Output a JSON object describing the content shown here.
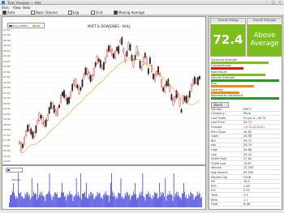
{
  "window": {
    "title": "Tickr Analysis — AAL"
  },
  "menu": [
    "Files",
    "View",
    "Help"
  ],
  "toolbar": [
    {
      "label": "Auto",
      "checked": true
    },
    {
      "label": "Basic Volume",
      "checked": false
    },
    {
      "label": "Log",
      "checked": false
    },
    {
      "label": "Grid",
      "checked": false
    },
    {
      "label": "Moving Average",
      "checked": true
    }
  ],
  "chart": {
    "title": "MSFT & DOWJONES - NULL",
    "legend": [
      "Price (MSFT)",
      "MA"
    ],
    "y_ticks": [
      "27.50",
      "27.00",
      "26.50",
      "26.00",
      "25.50",
      "25.00",
      "24.50",
      "24.00",
      "23.50",
      "23.00",
      "22.50",
      "22.00",
      "21.50",
      "21.00",
      "20.50",
      "20.00",
      "19.50",
      "19.00",
      "18.50",
      "18.00",
      "17.50",
      "17.00",
      "16.50",
      "16.00",
      "15.50",
      "15.00"
    ],
    "volume_legend": "Volume",
    "colors": {
      "up": "#d41010",
      "down": "#222222",
      "ma": "#e8a21c",
      "volume": "#2a2ad8"
    }
  },
  "scores": [
    {
      "header": "Overall Rating",
      "value": "72.4"
    },
    {
      "header": "Overall Strength",
      "value": "Above Average"
    }
  ],
  "bars": [
    {
      "label": "Technical Strength",
      "level": 0.82,
      "color": "#7cbf1a"
    },
    {
      "label": "Fundamentals",
      "level": 0.47,
      "color": "#e01a10"
    },
    {
      "label": "Momentum",
      "level": 0.78,
      "color": "#7cbf1a"
    },
    {
      "label": "Volume Strength",
      "level": 0.98,
      "color": "#1f9e1f"
    },
    {
      "label": "Risk",
      "level": 0.62,
      "color": "#f08a10"
    },
    {
      "label": "Volatility",
      "level": 0.41,
      "color": "#f08a10"
    },
    {
      "label": "Momentum Sentiment",
      "level": 0.98,
      "color": "#1f9e1f"
    }
  ],
  "details": {
    "tab_label": "Stock",
    "rows": [
      [
        "Symbol",
        "MSFT"
      ],
      [
        "Company",
        "Micro"
      ],
      [
        "Last Trade",
        "Fri Jan 4 - 26.74"
      ],
      [
        "Last Price",
        "26.74"
      ],
      [
        "Change",
        "+0.12 (0.45%)"
      ],
      [
        "Prev Close",
        "26.62"
      ],
      [
        "Open",
        "26.58"
      ],
      [
        "Bid",
        "26.72"
      ],
      [
        "Ask",
        "26.75"
      ],
      [
        "High",
        "26.88"
      ],
      [
        "Low",
        "26.42"
      ],
      [
        "52Wk High",
        "27.64"
      ],
      [
        "52Wk Low",
        "19.67"
      ],
      [
        "Volume",
        "12,345"
      ],
      [
        "Avg Volume",
        "65,000"
      ],
      [
        "Market Cap",
        "222B"
      ],
      [
        "P/E",
        "16.2"
      ],
      [
        "EPS",
        "1.65"
      ],
      [
        "Div",
        "0.92"
      ],
      [
        "Yield",
        "3.4"
      ],
      [
        "Beta",
        "1.1"
      ],
      [
        "Float",
        "8.4B"
      ]
    ]
  }
}
